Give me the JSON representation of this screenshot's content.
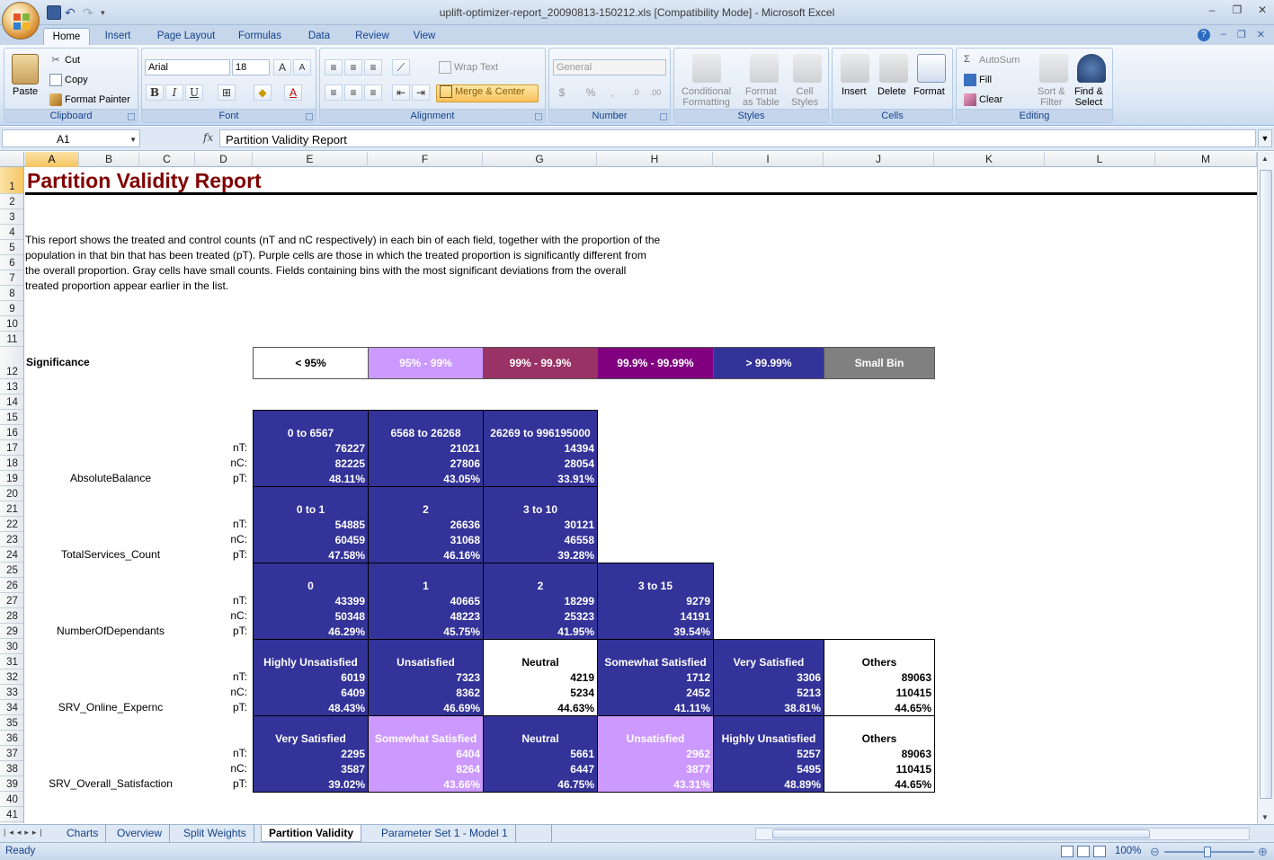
{
  "window": {
    "title": "uplift-optimizer-report_20090813-150212.xls  [Compatibility Mode] - Microsoft Excel"
  },
  "ribbon": {
    "tabs": [
      "Home",
      "Insert",
      "Page Layout",
      "Formulas",
      "Data",
      "Review",
      "View"
    ],
    "active_tab": "Home",
    "clipboard": {
      "paste": "Paste",
      "cut": "Cut",
      "copy": "Copy",
      "format_painter": "Format Painter",
      "label": "Clipboard"
    },
    "font": {
      "name": "Arial",
      "size": "18",
      "label": "Font"
    },
    "alignment": {
      "wrap_text": "Wrap Text",
      "merge_center": "Merge & Center",
      "label": "Alignment"
    },
    "number": {
      "format": "General",
      "label": "Number"
    },
    "styles": {
      "conditional_1": "Conditional",
      "conditional_2": "Formatting",
      "table_1": "Format",
      "table_2": "as Table",
      "cell_1": "Cell",
      "cell_2": "Styles",
      "label": "Styles"
    },
    "cells": {
      "insert": "Insert",
      "delete": "Delete",
      "format": "Format",
      "label": "Cells"
    },
    "editing": {
      "autosum": "AutoSum",
      "fill": "Fill",
      "clear": "Clear",
      "sort_1": "Sort &",
      "sort_2": "Filter",
      "find_1": "Find &",
      "find_2": "Select",
      "label": "Editing"
    }
  },
  "formula_bar": {
    "name_box": "A1",
    "fx": "fx",
    "formula": "Partition Validity Report"
  },
  "grid": {
    "columns": [
      "A",
      "B",
      "C",
      "D",
      "E",
      "F",
      "G",
      "H",
      "I",
      "J",
      "K",
      "L",
      "M"
    ],
    "rows": [
      "1",
      "2",
      "3",
      "4",
      "5",
      "6",
      "7",
      "8",
      "9",
      "10",
      "11",
      "12",
      "13",
      "14",
      "15",
      "16",
      "17",
      "18",
      "19",
      "20",
      "21",
      "22",
      "23",
      "24",
      "25",
      "26",
      "27",
      "28",
      "29",
      "30",
      "31",
      "32",
      "33",
      "34",
      "35",
      "36",
      "37",
      "38",
      "39",
      "40",
      "41"
    ]
  },
  "report": {
    "title": "Partition Validity Report",
    "intro_lines": [
      "This report shows the treated and control counts (nT and nC respectively) in each bin of each field, together with the proportion of the",
      "population in that bin that has been treated (pT). Purple cells are those in which the treated proportion is significantly different from",
      "the overall proportion. Gray cells have small counts. Fields containing bins with the most significant deviations from the overall",
      "treated proportion appear earlier in the list."
    ],
    "significance_label": "Significance",
    "legend": [
      {
        "label": "< 95%",
        "bg": "#ffffff",
        "fg": "#000000"
      },
      {
        "label": "95% - 99%",
        "bg": "#cc99ff",
        "fg": "#ffffff"
      },
      {
        "label": "99% - 99.9%",
        "bg": "#993366",
        "fg": "#ffffff"
      },
      {
        "label": "99.9% - 99.99%",
        "bg": "#800080",
        "fg": "#ffffff"
      },
      {
        "label": "> 99.99%",
        "bg": "#333399",
        "fg": "#ffffff"
      },
      {
        "label": "Small Bin",
        "bg": "#808080",
        "fg": "#ffffff"
      }
    ],
    "stat_labels": {
      "nT": "nT:",
      "nC": "nC:",
      "pT": "pT:"
    },
    "fields": [
      {
        "name": "AbsoluteBalance",
        "bins": [
          {
            "label": "0 to 6567",
            "nT": "76227",
            "nC": "82225",
            "pT": "48.11%",
            "level": 4
          },
          {
            "label": "6568 to 26268",
            "nT": "21021",
            "nC": "27806",
            "pT": "43.05%",
            "level": 4
          },
          {
            "label": "26269 to 996195000",
            "nT": "14394",
            "nC": "28054",
            "pT": "33.91%",
            "level": 4
          }
        ]
      },
      {
        "name": "TotalServices_Count",
        "bins": [
          {
            "label": "0 to 1",
            "nT": "54885",
            "nC": "60459",
            "pT": "47.58%",
            "level": 4
          },
          {
            "label": "2",
            "nT": "26636",
            "nC": "31068",
            "pT": "46.16%",
            "level": 4
          },
          {
            "label": "3 to 10",
            "nT": "30121",
            "nC": "46558",
            "pT": "39.28%",
            "level": 4
          }
        ]
      },
      {
        "name": "NumberOfDependants",
        "bins": [
          {
            "label": "0",
            "nT": "43399",
            "nC": "50348",
            "pT": "46.29%",
            "level": 4
          },
          {
            "label": "1",
            "nT": "40665",
            "nC": "48223",
            "pT": "45.75%",
            "level": 4
          },
          {
            "label": "2",
            "nT": "18299",
            "nC": "25323",
            "pT": "41.95%",
            "level": 4
          },
          {
            "label": "3 to 15",
            "nT": "9279",
            "nC": "14191",
            "pT": "39.54%",
            "level": 4
          }
        ]
      },
      {
        "name": "SRV_Online_Expernc",
        "bins": [
          {
            "label": "Highly Unsatisfied",
            "nT": "6019",
            "nC": "6409",
            "pT": "48.43%",
            "level": 4
          },
          {
            "label": "Unsatisfied",
            "nT": "7323",
            "nC": "8362",
            "pT": "46.69%",
            "level": 4
          },
          {
            "label": "Neutral",
            "nT": "4219",
            "nC": "5234",
            "pT": "44.63%",
            "level": 0
          },
          {
            "label": "Somewhat Satisfied",
            "nT": "1712",
            "nC": "2452",
            "pT": "41.11%",
            "level": 4
          },
          {
            "label": "Very Satisfied",
            "nT": "3306",
            "nC": "5213",
            "pT": "38.81%",
            "level": 4
          },
          {
            "label": "Others",
            "nT": "89063",
            "nC": "110415",
            "pT": "44.65%",
            "level": 0
          }
        ]
      },
      {
        "name": "SRV_Overall_Satisfaction",
        "bins": [
          {
            "label": "Very Satisfied",
            "nT": "2295",
            "nC": "3587",
            "pT": "39.02%",
            "level": 4
          },
          {
            "label": "Somewhat Satisfied",
            "nT": "6404",
            "nC": "8264",
            "pT": "43.66%",
            "level": 1
          },
          {
            "label": "Neutral",
            "nT": "5661",
            "nC": "6447",
            "pT": "46.75%",
            "level": 4
          },
          {
            "label": "Unsatisfied",
            "nT": "2962",
            "nC": "3877",
            "pT": "43.31%",
            "level": 1
          },
          {
            "label": "Highly Unsatisfied",
            "nT": "5257",
            "nC": "5495",
            "pT": "48.89%",
            "level": 4
          },
          {
            "label": "Others",
            "nT": "89063",
            "nC": "110415",
            "pT": "44.65%",
            "level": 0
          }
        ]
      }
    ]
  },
  "sheet_tabs": [
    "Charts",
    "Overview",
    "Split Weights",
    "Partition Validity",
    "Parameter Set 1 - Model 1"
  ],
  "active_sheet": "Partition Validity",
  "status": {
    "text": "Ready",
    "zoom": "100%"
  }
}
